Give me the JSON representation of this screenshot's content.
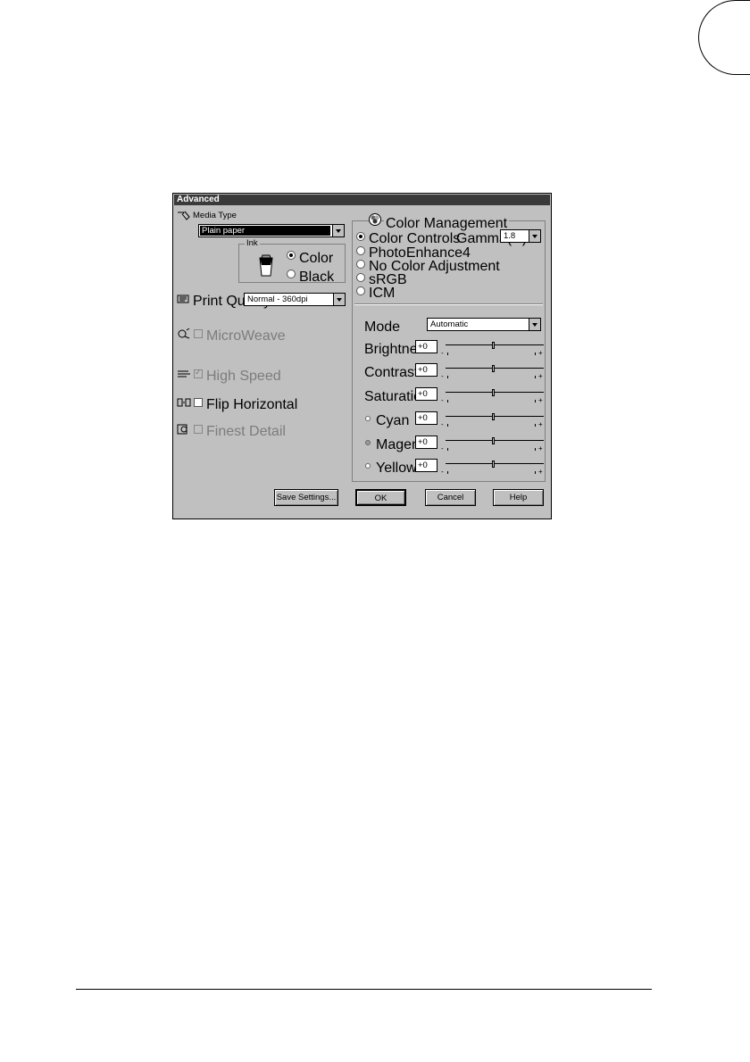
{
  "dialog": {
    "title": "Advanced",
    "media_type": {
      "label": "Media Type",
      "value": "Plain paper"
    },
    "ink": {
      "title": "Ink",
      "options": [
        "Color",
        "Black"
      ],
      "selected": "Color"
    },
    "print_quality": {
      "label": "Print Quality",
      "value": "Normal - 360dpi"
    },
    "options": [
      {
        "label": "MicroWeave",
        "checked": false,
        "enabled": false
      },
      {
        "label": "High Speed",
        "checked": true,
        "enabled": false
      },
      {
        "label": "Flip Horizontal",
        "checked": false,
        "enabled": true
      },
      {
        "label": "Finest Detail",
        "checked": false,
        "enabled": false
      }
    ],
    "color_management": {
      "title": "Color Management",
      "modes": [
        "Color Controls",
        "PhotoEnhance4",
        "No Color Adjustment",
        "sRGB",
        "ICM"
      ],
      "selected": "Color Controls",
      "gamma": {
        "label": "Gamma(D)",
        "value": "1.8"
      },
      "mode": {
        "label": "Mode",
        "value": "Automatic"
      },
      "adjustments": [
        {
          "label": "Brightness",
          "value": "+0",
          "level": 0
        },
        {
          "label": "Contrast",
          "value": "+0",
          "level": 0
        },
        {
          "label": "Saturation",
          "value": "+0",
          "level": 0
        },
        {
          "label": "Cyan",
          "value": "+0",
          "level": 0,
          "dot_color": "#ffffff"
        },
        {
          "label": "Magenta",
          "value": "+0",
          "level": 0,
          "dot_color": "#9a9a9a"
        },
        {
          "label": "Yellow",
          "value": "+0",
          "level": 0,
          "dot_color": "#ffffff"
        }
      ],
      "slider_minus": "-",
      "slider_plus": "+"
    },
    "buttons": {
      "save_settings": "Save Settings...",
      "ok": "OK",
      "cancel": "Cancel",
      "help": "Help"
    }
  }
}
